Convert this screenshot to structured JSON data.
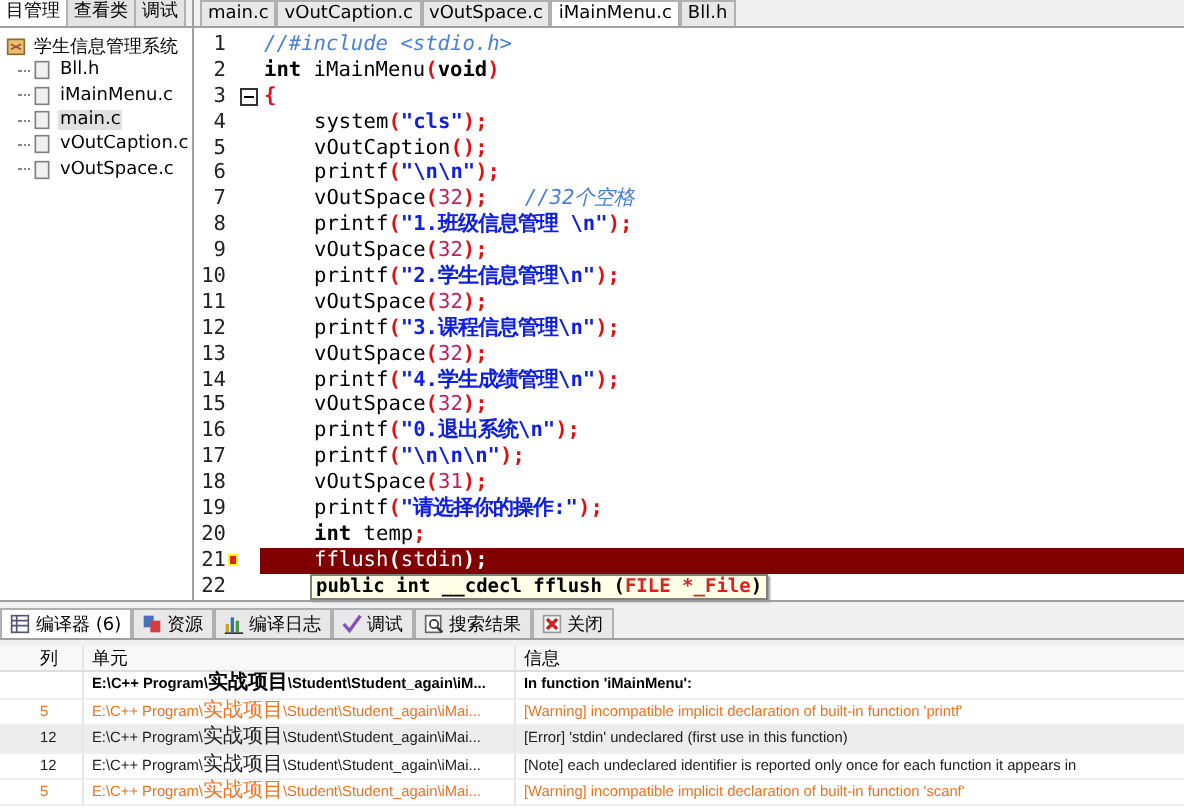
{
  "left_panel": {
    "tabs": [
      {
        "label": "目管理",
        "selected": true
      },
      {
        "label": "查看类",
        "selected": false
      },
      {
        "label": "调试",
        "selected": false
      }
    ],
    "tree": {
      "label": "学生信息管理系统",
      "children": [
        {
          "label": "Bll.h",
          "selected": false
        },
        {
          "label": "iMainMenu.c",
          "selected": false
        },
        {
          "label": "main.c",
          "selected": true
        },
        {
          "label": "vOutCaption.c",
          "selected": false
        },
        {
          "label": "vOutSpace.c",
          "selected": false
        }
      ]
    }
  },
  "editor": {
    "tabs": [
      {
        "label": "main.c",
        "selected": false
      },
      {
        "label": "vOutCaption.c",
        "selected": false
      },
      {
        "label": "vOutSpace.c",
        "selected": false
      },
      {
        "label": "iMainMenu.c",
        "selected": true
      },
      {
        "label": "Bll.h",
        "selected": false
      }
    ],
    "lines": [
      {
        "number": "1",
        "indented": false,
        "tokens": [
          {
            "kind": "comment",
            "text": "//#include <stdio.h>"
          }
        ]
      },
      {
        "number": "2",
        "indented": false,
        "tokens": [
          {
            "kind": "keyword",
            "text": "int"
          },
          {
            "kind": "plain",
            "text": " iMainMenu"
          },
          {
            "kind": "symbol",
            "text": "("
          },
          {
            "kind": "keyword",
            "text": "void"
          },
          {
            "kind": "symbol",
            "text": ")"
          }
        ]
      },
      {
        "number": "3",
        "indented": false,
        "fold": true,
        "tokens": [
          {
            "kind": "symbol",
            "text": "{"
          }
        ]
      },
      {
        "number": "4",
        "indented": true,
        "tokens": [
          {
            "kind": "plain",
            "text": "system"
          },
          {
            "kind": "symbol",
            "text": "("
          },
          {
            "kind": "string",
            "text": "\"cls\""
          },
          {
            "kind": "symbol",
            "text": ");"
          }
        ]
      },
      {
        "number": "5",
        "indented": true,
        "tokens": [
          {
            "kind": "plain",
            "text": "vOutCaption"
          },
          {
            "kind": "symbol",
            "text": "();"
          }
        ]
      },
      {
        "number": "6",
        "indented": true,
        "tokens": [
          {
            "kind": "plain",
            "text": "printf"
          },
          {
            "kind": "symbol",
            "text": "("
          },
          {
            "kind": "string",
            "text": "\"\\n\\n\""
          },
          {
            "kind": "symbol",
            "text": ");"
          }
        ]
      },
      {
        "number": "7",
        "indented": true,
        "tokens": [
          {
            "kind": "plain",
            "text": "vOutSpace"
          },
          {
            "kind": "symbol",
            "text": "("
          },
          {
            "kind": "number",
            "text": "32"
          },
          {
            "kind": "symbol",
            "text": ");"
          },
          {
            "kind": "comment",
            "text": "   //32个空格"
          }
        ]
      },
      {
        "number": "8",
        "indented": true,
        "tokens": [
          {
            "kind": "plain",
            "text": "printf"
          },
          {
            "kind": "symbol",
            "text": "("
          },
          {
            "kind": "string",
            "text": "\"1.班级信息管理 \\n\""
          },
          {
            "kind": "symbol",
            "text": ");"
          }
        ]
      },
      {
        "number": "9",
        "indented": true,
        "tokens": [
          {
            "kind": "plain",
            "text": "vOutSpace"
          },
          {
            "kind": "symbol",
            "text": "("
          },
          {
            "kind": "number",
            "text": "32"
          },
          {
            "kind": "symbol",
            "text": ");"
          }
        ]
      },
      {
        "number": "10",
        "indented": true,
        "tokens": [
          {
            "kind": "plain",
            "text": "printf"
          },
          {
            "kind": "symbol",
            "text": "("
          },
          {
            "kind": "string",
            "text": "\"2.学生信息管理\\n\""
          },
          {
            "kind": "symbol",
            "text": ");"
          }
        ]
      },
      {
        "number": "11",
        "indented": true,
        "tokens": [
          {
            "kind": "plain",
            "text": "vOutSpace"
          },
          {
            "kind": "symbol",
            "text": "("
          },
          {
            "kind": "number",
            "text": "32"
          },
          {
            "kind": "symbol",
            "text": ");"
          }
        ]
      },
      {
        "number": "12",
        "indented": true,
        "tokens": [
          {
            "kind": "plain",
            "text": "printf"
          },
          {
            "kind": "symbol",
            "text": "("
          },
          {
            "kind": "string",
            "text": "\"3.课程信息管理\\n\""
          },
          {
            "kind": "symbol",
            "text": ");"
          }
        ]
      },
      {
        "number": "13",
        "indented": true,
        "tokens": [
          {
            "kind": "plain",
            "text": "vOutSpace"
          },
          {
            "kind": "symbol",
            "text": "("
          },
          {
            "kind": "number",
            "text": "32"
          },
          {
            "kind": "symbol",
            "text": ");"
          }
        ]
      },
      {
        "number": "14",
        "indented": true,
        "tokens": [
          {
            "kind": "plain",
            "text": "printf"
          },
          {
            "kind": "symbol",
            "text": "("
          },
          {
            "kind": "string",
            "text": "\"4.学生成绩管理\\n\""
          },
          {
            "kind": "symbol",
            "text": ");"
          }
        ]
      },
      {
        "number": "15",
        "indented": true,
        "tokens": [
          {
            "kind": "plain",
            "text": "vOutSpace"
          },
          {
            "kind": "symbol",
            "text": "("
          },
          {
            "kind": "number",
            "text": "32"
          },
          {
            "kind": "symbol",
            "text": ");"
          }
        ]
      },
      {
        "number": "16",
        "indented": true,
        "tokens": [
          {
            "kind": "plain",
            "text": "printf"
          },
          {
            "kind": "symbol",
            "text": "("
          },
          {
            "kind": "string",
            "text": "\"0.退出系统\\n\""
          },
          {
            "kind": "symbol",
            "text": ");"
          }
        ]
      },
      {
        "number": "17",
        "indented": true,
        "tokens": [
          {
            "kind": "plain",
            "text": "printf"
          },
          {
            "kind": "symbol",
            "text": "("
          },
          {
            "kind": "string",
            "text": "\"\\n\\n\\n\""
          },
          {
            "kind": "symbol",
            "text": ");"
          }
        ]
      },
      {
        "number": "18",
        "indented": true,
        "tokens": [
          {
            "kind": "plain",
            "text": "vOutSpace"
          },
          {
            "kind": "symbol",
            "text": "("
          },
          {
            "kind": "number",
            "text": "31"
          },
          {
            "kind": "symbol",
            "text": ");"
          }
        ]
      },
      {
        "number": "19",
        "indented": true,
        "tokens": [
          {
            "kind": "plain",
            "text": "printf"
          },
          {
            "kind": "symbol",
            "text": "("
          },
          {
            "kind": "string",
            "text": "\"请选择你的操作:\""
          },
          {
            "kind": "symbol",
            "text": ");"
          }
        ]
      },
      {
        "number": "20",
        "indented": true,
        "tokens": [
          {
            "kind": "keyword",
            "text": "int"
          },
          {
            "kind": "plain",
            "text": " temp"
          },
          {
            "kind": "symbol",
            "text": ";"
          }
        ]
      },
      {
        "number": "21",
        "indented": true,
        "highlighted": true,
        "error_mark": true,
        "tokens": [
          {
            "kind": "plain",
            "text": "fflush"
          },
          {
            "kind": "symbol",
            "text": "("
          },
          {
            "kind": "plain",
            "text": "stdin"
          },
          {
            "kind": "symbol",
            "text": ");"
          }
        ]
      },
      {
        "number": "22"
      }
    ],
    "tooltip": [
      {
        "kind": "plain",
        "text": "public int __cdecl fflush ("
      },
      {
        "kind": "param",
        "text": "FILE *_File"
      },
      {
        "kind": "plain",
        "text": ")"
      }
    ]
  },
  "bottom_panel": {
    "tabs": [
      {
        "label": "编译器 (6)",
        "selected": true
      },
      {
        "label": "资源",
        "selected": false
      },
      {
        "label": "编译日志",
        "selected": false
      },
      {
        "label": "调试",
        "selected": false
      },
      {
        "label": "搜索结果",
        "selected": false
      },
      {
        "label": "关闭",
        "selected": false
      }
    ],
    "columns": [
      "列",
      "单元",
      "信息"
    ],
    "rows": [
      {
        "kind": "header",
        "selected": false,
        "column": "",
        "unit": "E:\\C++ Program\\实战项目\\Student\\Student_again\\iM...",
        "message": "In function 'iMainMenu':"
      },
      {
        "kind": "warning",
        "selected": false,
        "column": "5",
        "unit": "E:\\C++ Program\\实战项目\\Student\\Student_again\\iMai...",
        "message": "[Warning] incompatible implicit declaration of built-in function 'printf'"
      },
      {
        "kind": "error",
        "selected": true,
        "column": "12",
        "unit": "E:\\C++ Program\\实战项目\\Student\\Student_again\\iMai...",
        "message": "[Error] 'stdin' undeclared (first use in this function)"
      },
      {
        "kind": "note",
        "selected": false,
        "column": "12",
        "unit": "E:\\C++ Program\\实战项目\\Student\\Student_again\\iMai...",
        "message": "[Note] each undeclared identifier is reported only once for each function it appears in"
      },
      {
        "kind": "warning",
        "selected": false,
        "column": "5",
        "unit": "E:\\C++ Program\\实战项目\\Student\\Student_again\\iMai...",
        "message": "[Warning] incompatible implicit declaration of built-in function 'scanf'"
      }
    ]
  }
}
